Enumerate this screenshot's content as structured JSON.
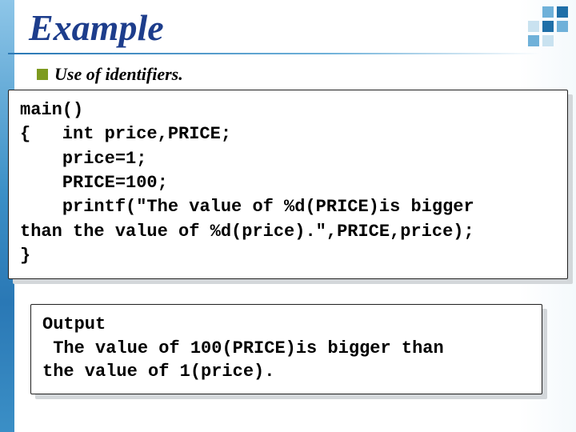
{
  "title": "Example",
  "bullet": "Use of identifiers.",
  "code_block": "main()\n{   int price,PRICE;\n    price=1;\n    PRICE=100;\n    printf(\"The value of %d(PRICE)is bigger\nthan the value of %d(price).\",PRICE,price);\n}",
  "output_block": "Output\n The value of 100(PRICE)is bigger than\nthe value of 1(price)."
}
